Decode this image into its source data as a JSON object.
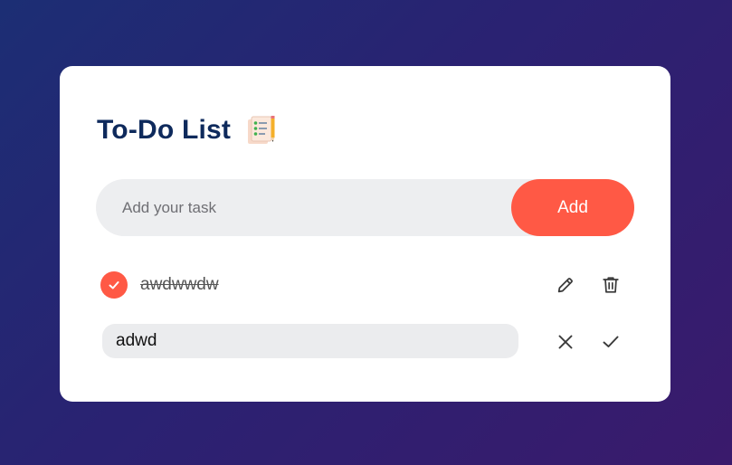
{
  "header": {
    "title": "To-Do List",
    "title_icon": "notepad-checklist-icon"
  },
  "new_task": {
    "placeholder": "Add your task",
    "value": "",
    "add_label": "Add"
  },
  "tasks": [
    {
      "text": "awdwwdw",
      "completed": true,
      "mode": "view",
      "actions": [
        "edit-icon",
        "trash-icon"
      ]
    },
    {
      "text": "adwd",
      "completed": false,
      "mode": "editing",
      "actions": [
        "close-icon",
        "check-icon"
      ]
    }
  ],
  "colors": {
    "accent": "#ff5945",
    "title": "#0e2a5c",
    "background_start": "#1c2e74",
    "background_end": "#3a1a6c",
    "input_bg": "#edeef0"
  }
}
